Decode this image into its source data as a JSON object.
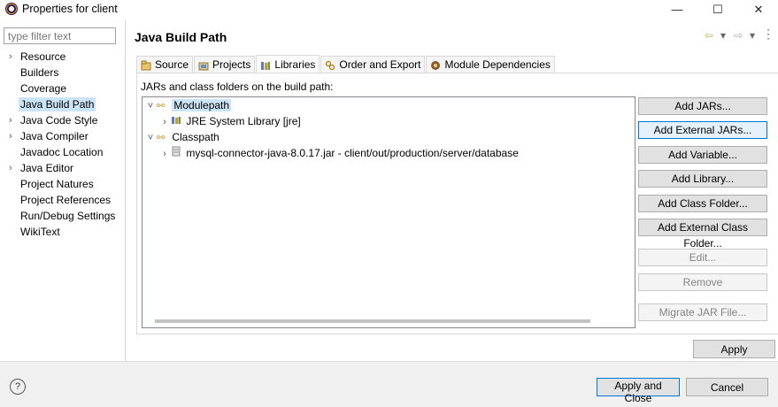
{
  "window": {
    "title": "Properties for client",
    "minimize": "—",
    "maximize": "☐",
    "close": "✕"
  },
  "sidebar": {
    "filter_placeholder": "type filter text",
    "items": [
      {
        "label": "Resource",
        "expandable": true
      },
      {
        "label": "Builders",
        "expandable": false
      },
      {
        "label": "Coverage",
        "expandable": false
      },
      {
        "label": "Java Build Path",
        "expandable": false,
        "selected": true
      },
      {
        "label": "Java Code Style",
        "expandable": true
      },
      {
        "label": "Java Compiler",
        "expandable": true
      },
      {
        "label": "Javadoc Location",
        "expandable": false
      },
      {
        "label": "Java Editor",
        "expandable": true
      },
      {
        "label": "Project Natures",
        "expandable": false
      },
      {
        "label": "Project References",
        "expandable": false
      },
      {
        "label": "Run/Debug Settings",
        "expandable": false
      },
      {
        "label": "WikiText",
        "expandable": false
      }
    ]
  },
  "page": {
    "title": "Java Build Path",
    "nav_back": "⇦",
    "nav_forward": "⇨",
    "menu_arrow": "▾"
  },
  "tabs": [
    {
      "label": "Source",
      "icon": "source-folder-icon"
    },
    {
      "label": "Projects",
      "icon": "projects-icon"
    },
    {
      "label": "Libraries",
      "icon": "libraries-icon",
      "active": true
    },
    {
      "label": "Order and Export",
      "icon": "order-export-icon"
    },
    {
      "label": "Module Dependencies",
      "icon": "module-dependencies-icon"
    }
  ],
  "libraries": {
    "section_label": "JARs and class folders on the build path:",
    "tree": {
      "modulepath": "Modulepath",
      "jre": "JRE System Library [jre]",
      "classpath": "Classpath",
      "jar": "mysql-connector-java-8.0.17.jar - client/out/production/server/database"
    },
    "buttons": {
      "add_jars": "Add JARs...",
      "add_external_jars": "Add External JARs...",
      "add_variable": "Add Variable...",
      "add_library": "Add Library...",
      "add_class_folder": "Add Class Folder...",
      "add_external_class_folder": "Add External Class Folder...",
      "edit": "Edit...",
      "remove": "Remove",
      "migrate_jar": "Migrate JAR File..."
    }
  },
  "footer": {
    "apply": "Apply",
    "help": "?",
    "apply_and_close": "Apply and Close",
    "cancel": "Cancel"
  },
  "colors": {
    "selection": "#cce4f7",
    "focus_border": "#0078d7",
    "button_bg": "#e1e1e1"
  }
}
